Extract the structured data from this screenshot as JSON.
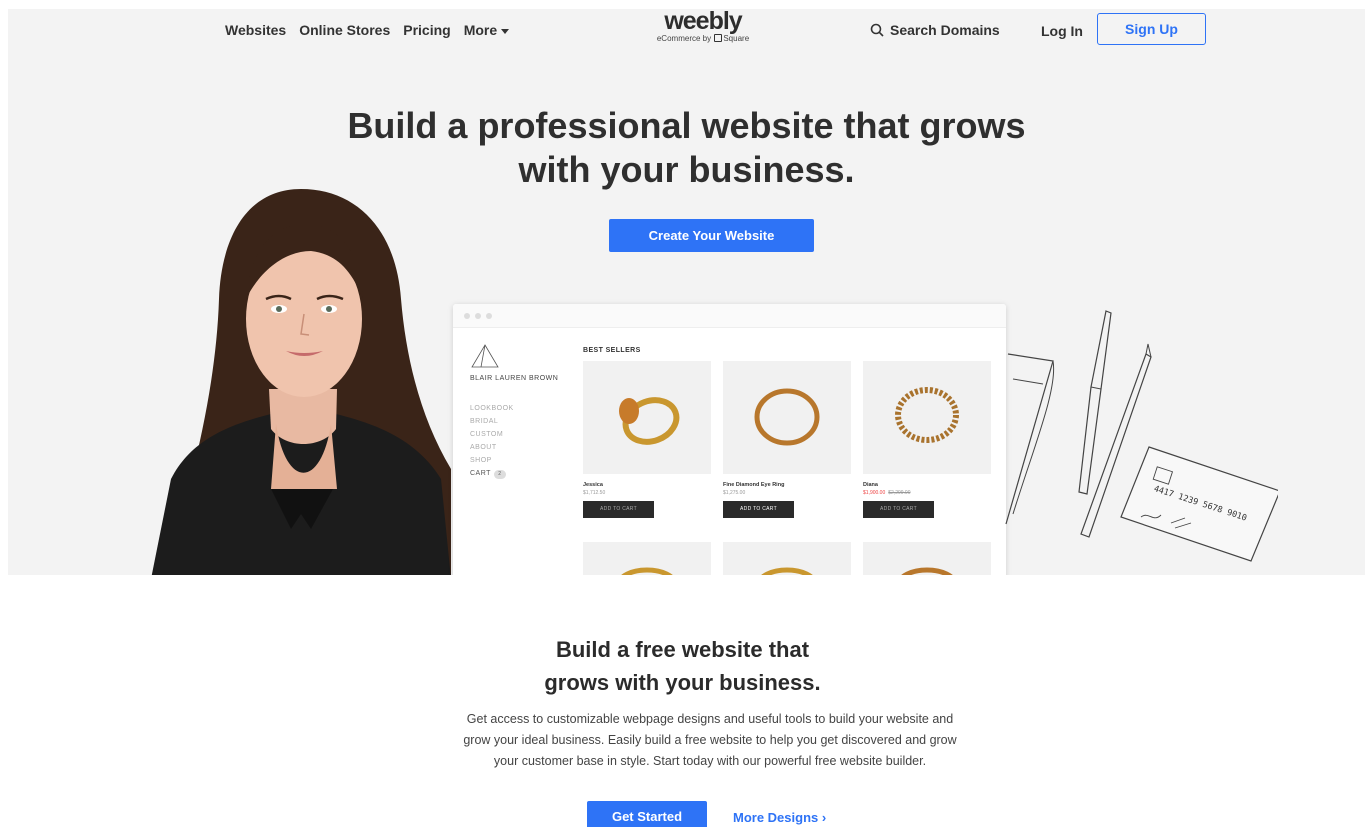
{
  "nav": {
    "links": [
      "Websites",
      "Online Stores",
      "Pricing"
    ],
    "more": "More",
    "logo_word": "weebly",
    "logo_sub_prefix": "eCommerce by",
    "logo_sub_brand": "Square",
    "search": "Search Domains",
    "login": "Log In",
    "signup": "Sign Up"
  },
  "hero": {
    "headline_line1": "Build a professional website that grows",
    "headline_line2": "with your business.",
    "cta": "Create Your Website"
  },
  "mock": {
    "brand": "BLAIR LAUREN BROWN",
    "menu": [
      "LOOKBOOK",
      "BRIDAL",
      "CUSTOM",
      "ABOUT",
      "SHOP"
    ],
    "cart": "CART",
    "cart_count": "2",
    "section": "BEST SELLERS",
    "products": [
      {
        "name": "Jessica",
        "price": "$1,712.50",
        "button": "ADD TO CART"
      },
      {
        "name": "Fine Diamond Eye Ring",
        "price": "$1,275.00",
        "button": "ADD TO CART"
      },
      {
        "name": "Diana",
        "price": "$1,900.00",
        "old_price": "$2,299.00",
        "button": "ADD TO CART"
      }
    ],
    "card_text": "4417 1239 5678 9010"
  },
  "lower": {
    "title_line1": "Build a free website that",
    "title_line2": "grows with your business.",
    "para_line1": "Get access to customizable webpage designs and useful tools to build your website and",
    "para_line2": "grow your ideal business. Easily build a free website to help you get discovered and grow",
    "para_line3": "your customer base in style. Start today with our powerful free website builder.",
    "get_started": "Get Started",
    "more_designs": "More Designs ›"
  },
  "colors": {
    "accent": "#2e73f6",
    "hero_bg": "#f3f3f3",
    "text": "#2b2b2b"
  }
}
